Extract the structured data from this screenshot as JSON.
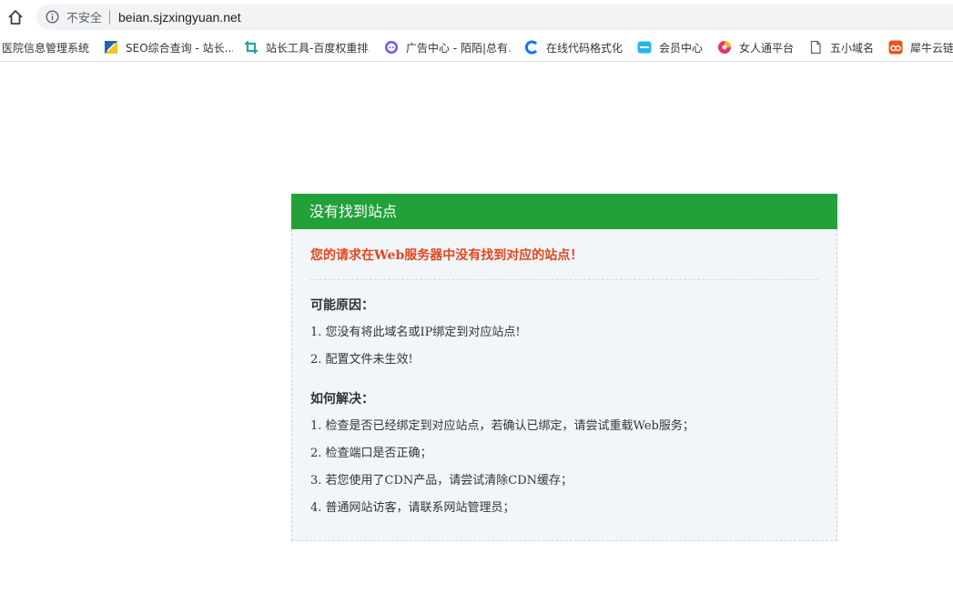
{
  "browser": {
    "security_label": "不安全",
    "url": "beian.sjzxingyuan.net"
  },
  "bookmarks": [
    {
      "label": "医院信息管理系统",
      "icon": "none"
    },
    {
      "label": "SEO综合查询 - 站长...",
      "icon": "seo-icon"
    },
    {
      "label": "站长工具-百度权重排...",
      "icon": "crop-icon"
    },
    {
      "label": "广告中心 - 陌陌|总有...",
      "icon": "momo-icon"
    },
    {
      "label": "在线代码格式化",
      "icon": "c-logo-icon"
    },
    {
      "label": "会员中心",
      "icon": "vip-icon"
    },
    {
      "label": "女人通平台",
      "icon": "circle-logo-icon"
    },
    {
      "label": "五小域名",
      "icon": "page-icon"
    },
    {
      "label": "犀牛云链",
      "icon": "rhino-icon"
    }
  ],
  "panel": {
    "header": "没有找到站点",
    "headline": "您的请求在Web服务器中没有找到对应的站点！",
    "reasons_title": "可能原因：",
    "reasons": [
      "1. 您没有将此域名或IP绑定到对应站点!",
      "2. 配置文件未生效!"
    ],
    "solutions_title": "如何解决：",
    "solutions": [
      "1. 检查是否已经绑定到对应站点，若确认已绑定，请尝试重载Web服务；",
      "2. 检查端口是否正确；",
      "3. 若您使用了CDN产品，请尝试清除CDN缓存；",
      "4. 普通网站访客，请联系网站管理员；"
    ]
  },
  "colors": {
    "header_green": "#22a13a",
    "headline_red": "#e2461e",
    "panel_bg": "#f2f6f8"
  }
}
